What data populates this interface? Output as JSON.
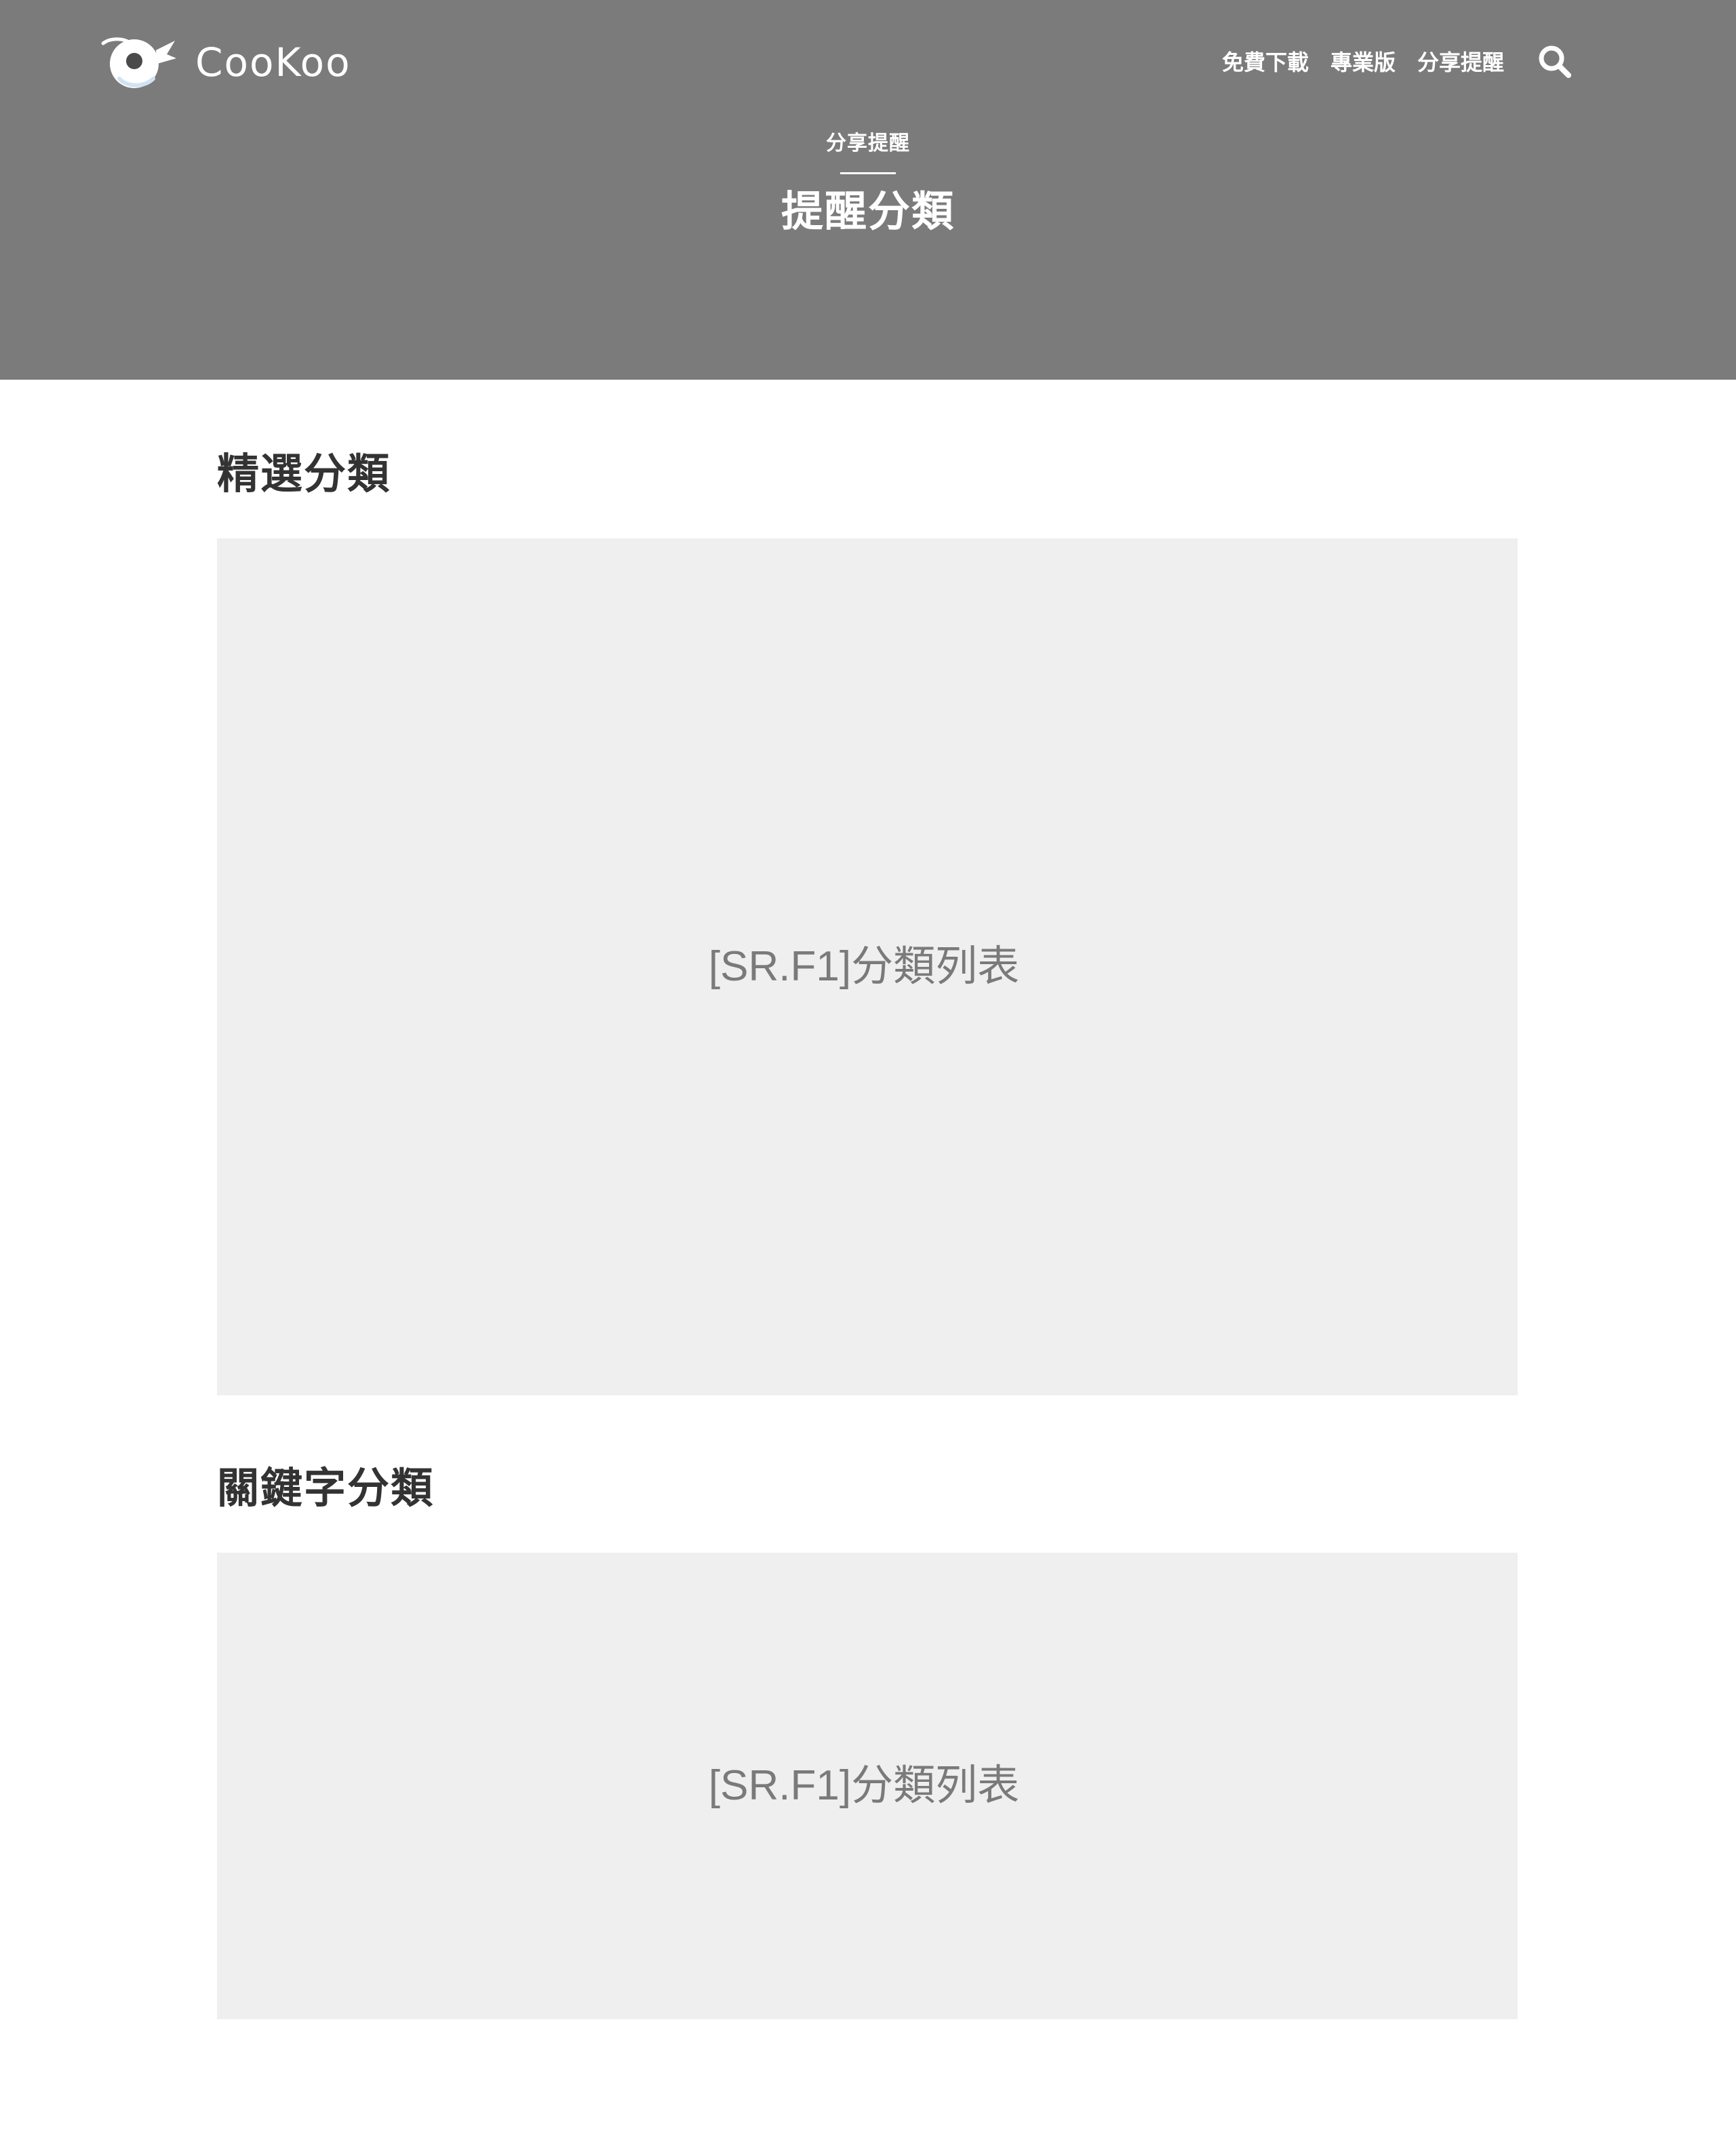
{
  "header": {
    "logo_text": "CooKoo",
    "nav": [
      "免費下載",
      "專業版",
      "分享提醒"
    ]
  },
  "hero": {
    "eyebrow": "分享提醒",
    "title": "提醒分類"
  },
  "sections": [
    {
      "heading": "精選分類",
      "placeholder": "[SR.F1]分類列表"
    },
    {
      "heading": "關鍵字分類",
      "placeholder": "[SR.F1]分類列表"
    }
  ],
  "colors": {
    "hero_bg": "#7b7b7b",
    "placeholder_bg": "#efefef",
    "heading": "#333333",
    "placeholder_text": "#7a7a7a"
  }
}
